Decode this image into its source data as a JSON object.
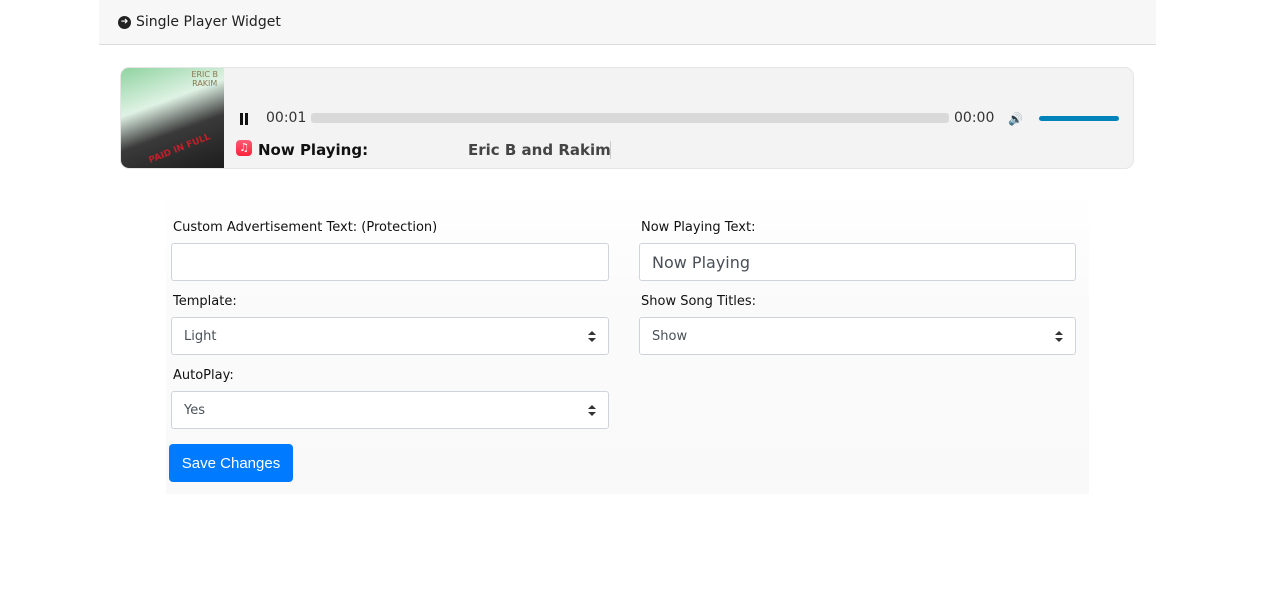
{
  "header": {
    "title": "Single Player Widget",
    "icon": "arrow-circle-right-icon"
  },
  "player": {
    "album_text": "ERIC B RAKIM",
    "album_red": "PAID IN FULL",
    "current_time": "00:01",
    "duration": "00:00",
    "progress": 0,
    "volume": 1.0,
    "now_playing_label": "Now Playing:",
    "song": "Eric B and Rakim - ",
    "accent": "#0083b8"
  },
  "form": {
    "ad_label": "Custom Advertisement Text: (Protection)",
    "ad_value": "",
    "np_label": "Now Playing Text:",
    "np_value": "Now Playing",
    "template_label": "Template:",
    "template_value": "Light",
    "titles_label": "Show Song Titles:",
    "titles_value": "Show",
    "autoplay_label": "AutoPlay:",
    "autoplay_value": "Yes",
    "save": "Save Changes"
  }
}
